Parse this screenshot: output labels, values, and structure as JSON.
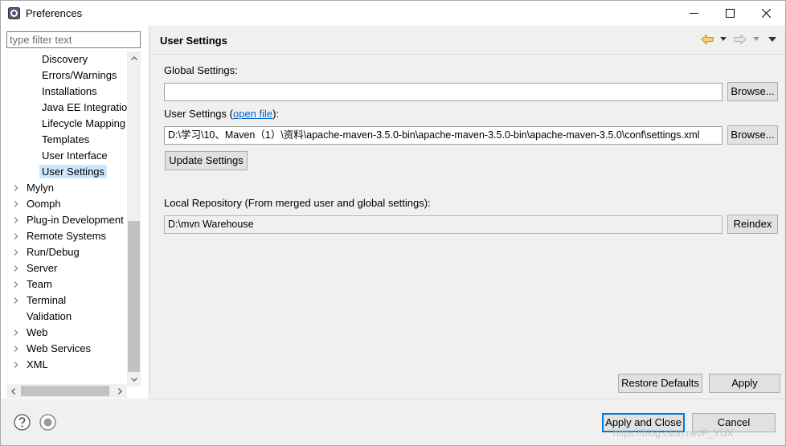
{
  "window": {
    "title": "Preferences"
  },
  "filter": {
    "placeholder": "type filter text"
  },
  "tree": {
    "items": [
      {
        "label": "Discovery",
        "level": 2,
        "expandable": false,
        "selected": false
      },
      {
        "label": "Errors/Warnings",
        "level": 2,
        "expandable": false,
        "selected": false
      },
      {
        "label": "Installations",
        "level": 2,
        "expandable": false,
        "selected": false
      },
      {
        "label": "Java EE Integration",
        "level": 2,
        "expandable": false,
        "selected": false
      },
      {
        "label": "Lifecycle Mapping",
        "level": 2,
        "expandable": false,
        "selected": false
      },
      {
        "label": "Templates",
        "level": 2,
        "expandable": false,
        "selected": false
      },
      {
        "label": "User Interface",
        "level": 2,
        "expandable": false,
        "selected": false
      },
      {
        "label": "User Settings",
        "level": 2,
        "expandable": false,
        "selected": true
      },
      {
        "label": "Mylyn",
        "level": 1,
        "expandable": true,
        "selected": false
      },
      {
        "label": "Oomph",
        "level": 1,
        "expandable": true,
        "selected": false
      },
      {
        "label": "Plug-in Development",
        "level": 1,
        "expandable": true,
        "selected": false
      },
      {
        "label": "Remote Systems",
        "level": 1,
        "expandable": true,
        "selected": false
      },
      {
        "label": "Run/Debug",
        "level": 1,
        "expandable": true,
        "selected": false
      },
      {
        "label": "Server",
        "level": 1,
        "expandable": true,
        "selected": false
      },
      {
        "label": "Team",
        "level": 1,
        "expandable": true,
        "selected": false
      },
      {
        "label": "Terminal",
        "level": 1,
        "expandable": true,
        "selected": false
      },
      {
        "label": "Validation",
        "level": 1,
        "expandable": false,
        "selected": false
      },
      {
        "label": "Web",
        "level": 1,
        "expandable": true,
        "selected": false
      },
      {
        "label": "Web Services",
        "level": 1,
        "expandable": true,
        "selected": false
      },
      {
        "label": "XML",
        "level": 1,
        "expandable": true,
        "selected": false
      }
    ]
  },
  "page": {
    "title": "User Settings",
    "global_label": "Global Settings:",
    "global_value": "",
    "browse_label": "Browse...",
    "user_label_prefix": "User Settings (",
    "user_label_link": "open file",
    "user_label_suffix": "):",
    "user_value": "D:\\学习\\10、Maven（1）\\资料\\apache-maven-3.5.0-bin\\apache-maven-3.5.0-bin\\apache-maven-3.5.0\\conf\\settings.xml",
    "update_label": "Update Settings",
    "local_repo_label": "Local Repository (From merged user and global settings):",
    "local_repo_value": "D:\\mvn Warehouse",
    "reindex_label": "Reindex",
    "restore_label": "Restore Defaults",
    "apply_label": "Apply"
  },
  "footer": {
    "apply_close_label": "Apply and Close",
    "cancel_label": "Cancel",
    "watermark": "https://blog.csdn.net/F_YUX"
  },
  "colors": {
    "selection": "#cce8ff",
    "link": "#0066cc",
    "default_button_border": "#0078d7",
    "nav_back_arrow": "#e8a33c"
  }
}
